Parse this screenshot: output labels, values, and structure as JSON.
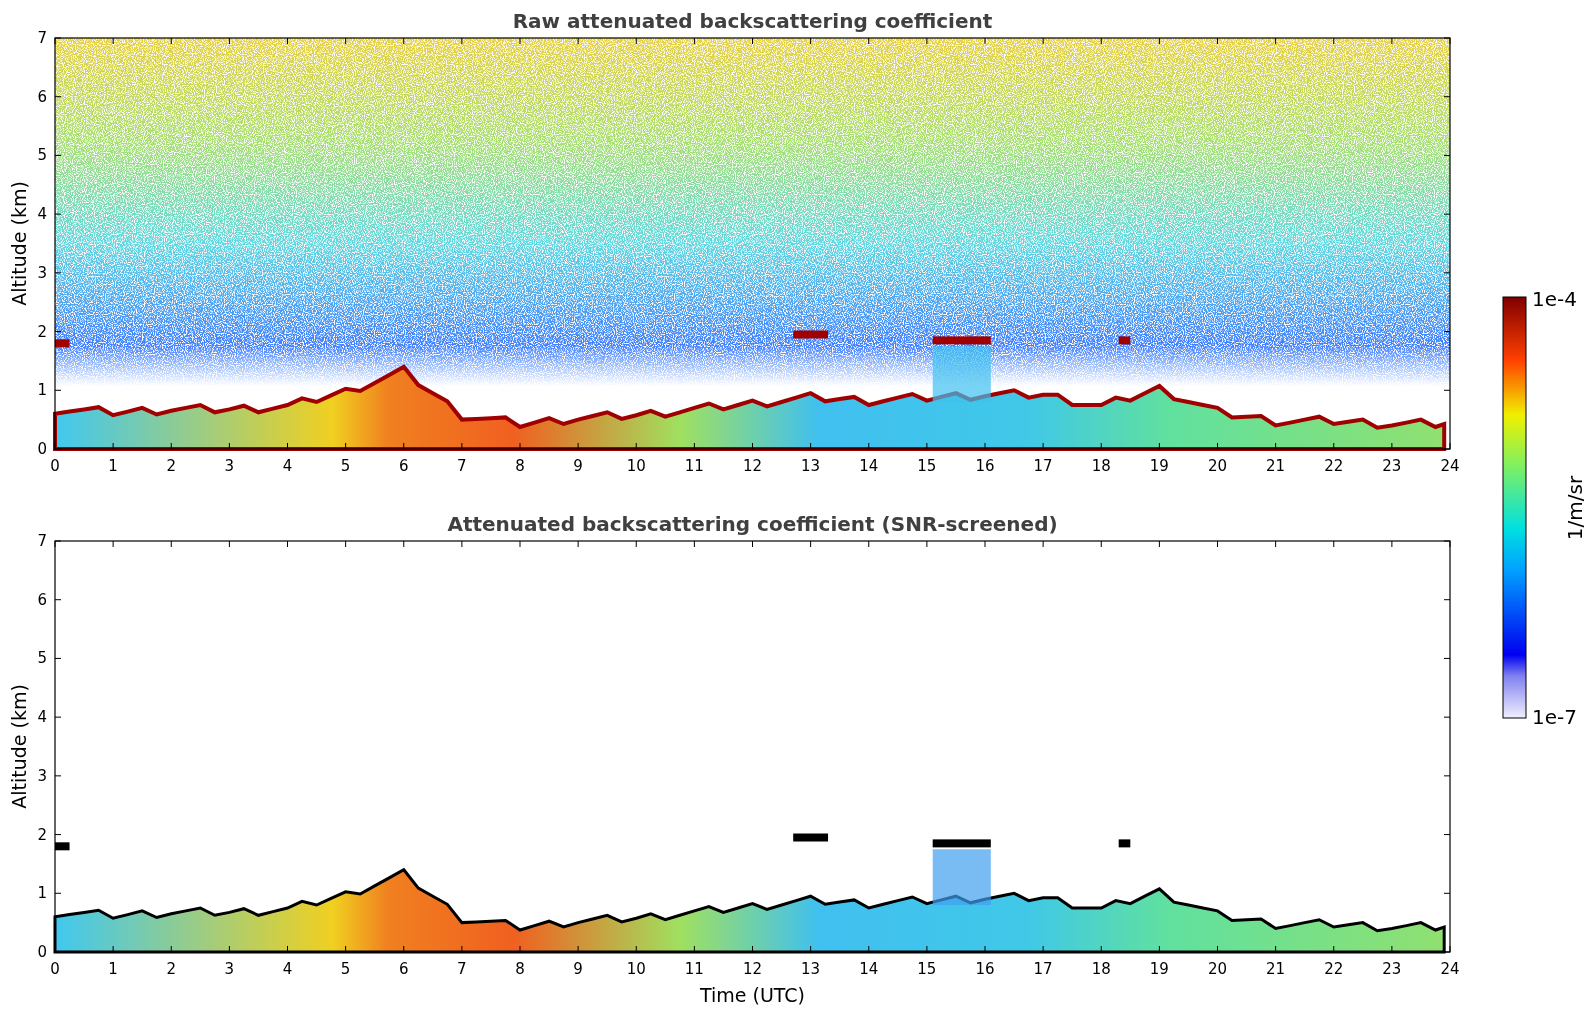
{
  "panels": [
    {
      "title": "Raw attenuated backscattering coefficient",
      "ylabel": "Altitude (km)",
      "yticks": [
        "7",
        "6",
        "5",
        "4",
        "3",
        "2",
        "1",
        "0"
      ],
      "xticks": [
        "0",
        "1",
        "2",
        "3",
        "4",
        "5",
        "6",
        "7",
        "8",
        "9",
        "10",
        "11",
        "12",
        "13",
        "14",
        "15",
        "16",
        "17",
        "18",
        "19",
        "20",
        "21",
        "22",
        "23",
        "24"
      ],
      "kind": "raw"
    },
    {
      "title": "Attenuated backscattering coefficient (SNR-screened)",
      "ylabel": "Altitude (km)",
      "yticks": [
        "7",
        "6",
        "5",
        "4",
        "3",
        "2",
        "1",
        "0"
      ],
      "xticks": [
        "0",
        "1",
        "2",
        "3",
        "4",
        "5",
        "6",
        "7",
        "8",
        "9",
        "10",
        "11",
        "12",
        "13",
        "14",
        "15",
        "16",
        "17",
        "18",
        "19",
        "20",
        "21",
        "22",
        "23",
        "24"
      ],
      "kind": "screened",
      "xlabel": "Time (UTC)"
    }
  ],
  "colorbar": {
    "max_label": "1e-4",
    "min_label": "1e-7",
    "label": "1/m/sr"
  }
}
